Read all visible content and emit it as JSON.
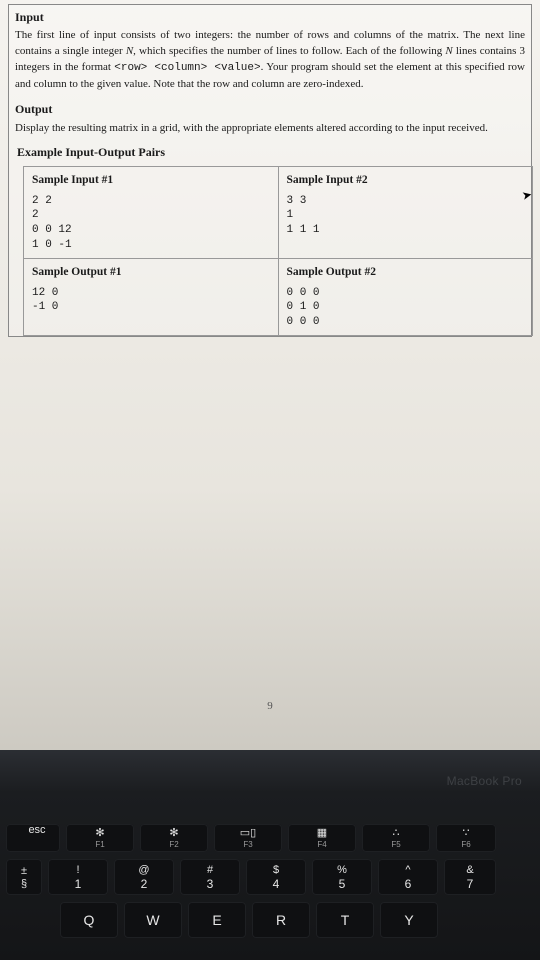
{
  "sections": {
    "input_title": "Input",
    "input_text_1": "The first line of input consists of two integers: the number of rows and columns of the matrix. The next line contains a single integer ",
    "input_text_N": "N",
    "input_text_2": ", which specifies the number of lines to follow. Each of the following ",
    "input_text_3": " lines contains 3 integers in the format ",
    "input_fmt": "<row> <column> <value>",
    "input_text_4": ". Your program should set the element at this specified row and column to the given value. Note that the row and column are zero-indexed.",
    "output_title": "Output",
    "output_text": "Display the resulting matrix in a grid, with the appropriate elements altered according to the input received.",
    "pairs_title": "Example Input-Output Pairs"
  },
  "samples": {
    "in1_head": "Sample Input #1",
    "in1": "2 2\n2\n0 0 12\n1 0 -1",
    "in2_head": "Sample Input #2",
    "in2": "3 3\n1\n1 1 1",
    "out1_head": "Sample Output #1",
    "out1": "12 0\n-1 0",
    "out2_head": "Sample Output #2",
    "out2": "0 0 0\n0 1 0\n0 0 0"
  },
  "page_number": "9",
  "brand": "MacBook Pro",
  "keys": {
    "esc": "esc",
    "fn": [
      {
        "g": "✻",
        "l": "F1"
      },
      {
        "g": "✻",
        "l": "F2"
      },
      {
        "g": "▭▯",
        "l": "F3"
      },
      {
        "g": "▦",
        "l": "F4"
      },
      {
        "g": "∴",
        "l": "F5"
      },
      {
        "g": "∵",
        "l": "F6"
      }
    ],
    "side_top": "±",
    "side_bot": "§",
    "nums": [
      {
        "s": "!",
        "n": "1"
      },
      {
        "s": "@",
        "n": "2"
      },
      {
        "s": "#",
        "n": "3"
      },
      {
        "s": "$",
        "n": "4"
      },
      {
        "s": "%",
        "n": "5"
      },
      {
        "s": "^",
        "n": "6"
      },
      {
        "s": "&",
        "n": "7"
      }
    ],
    "letters": [
      "Q",
      "W",
      "E",
      "R",
      "T",
      "Y"
    ]
  }
}
